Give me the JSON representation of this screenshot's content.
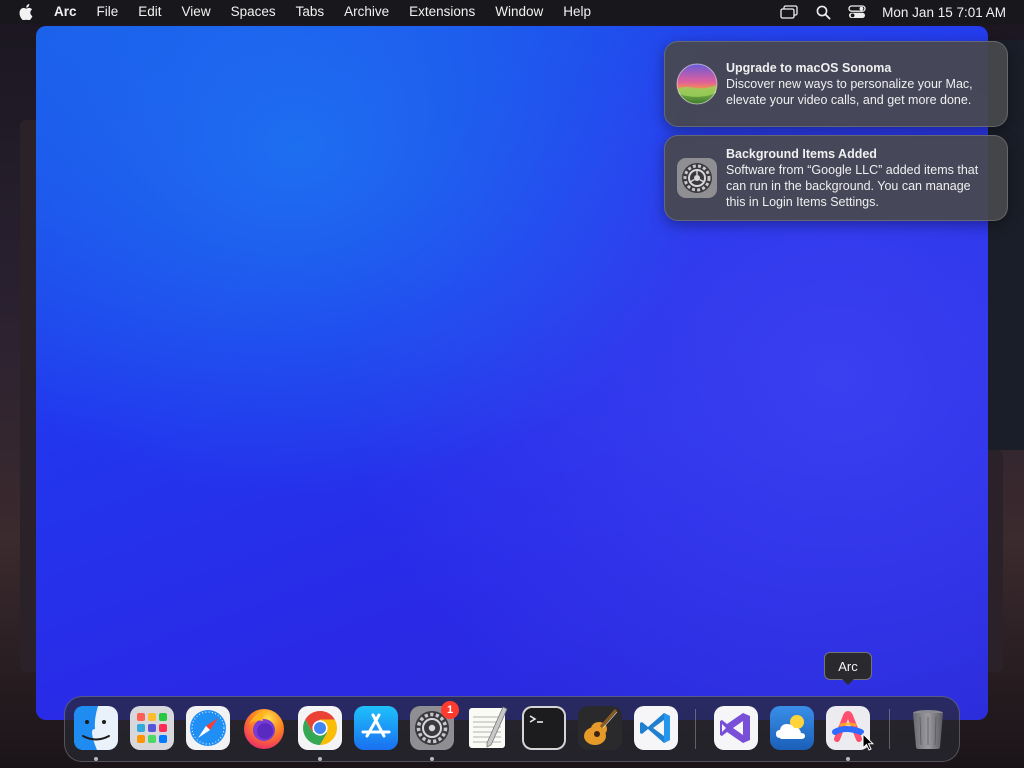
{
  "menubar": {
    "apple_icon": "apple-logo-icon",
    "app_name": "Arc",
    "items": [
      "File",
      "Edit",
      "View",
      "Spaces",
      "Tabs",
      "Archive",
      "Extensions",
      "Window",
      "Help"
    ],
    "status_icons": [
      "screen-mirroring-icon",
      "spotlight-search-icon",
      "control-center-icon"
    ],
    "clock": "Mon Jan 15  7:01 AM"
  },
  "notifications": [
    {
      "icon": "macos-sonoma-icon",
      "title": "Upgrade to macOS Sonoma",
      "body": "Discover new ways to personalize your Mac, elevate your video calls, and get more done."
    },
    {
      "icon": "system-settings-gear-icon",
      "title": "Background Items Added",
      "body": "Software from “Google LLC” added items that can run in the background. You can manage this in Login Items Settings."
    }
  ],
  "tooltip": {
    "label": "Arc"
  },
  "dock": {
    "items": [
      {
        "name": "Finder",
        "icon": "finder-icon",
        "running": true
      },
      {
        "name": "Launchpad",
        "icon": "launchpad-icon",
        "running": false
      },
      {
        "name": "Safari",
        "icon": "safari-icon",
        "running": false
      },
      {
        "name": "Firefox",
        "icon": "firefox-icon",
        "running": false
      },
      {
        "name": "Google Chrome",
        "icon": "chrome-icon",
        "running": true
      },
      {
        "name": "App Store",
        "icon": "app-store-icon",
        "running": false
      },
      {
        "name": "System Settings",
        "icon": "system-settings-icon",
        "running": true,
        "badge": "1"
      },
      {
        "name": "TextEdit",
        "icon": "textedit-icon",
        "running": false
      },
      {
        "name": "Terminal",
        "icon": "terminal-icon",
        "running": false
      },
      {
        "name": "GarageBand",
        "icon": "garageband-icon",
        "running": false
      },
      {
        "name": "Visual Studio Code",
        "icon": "vscode-icon",
        "running": false
      },
      {
        "name": "Visual Studio",
        "icon": "visual-studio-icon",
        "running": false
      },
      {
        "name": "Weather",
        "icon": "weather-icon",
        "running": false
      },
      {
        "name": "Arc",
        "icon": "arc-icon",
        "running": true
      },
      {
        "name": "Trash",
        "icon": "trash-icon",
        "running": false
      }
    ]
  },
  "colors": {
    "menubar_bg": "#17171c",
    "wallpaper_blue": "#2a2ae6",
    "badge_red": "#ff3b30",
    "notification_bg": "#48484c"
  }
}
